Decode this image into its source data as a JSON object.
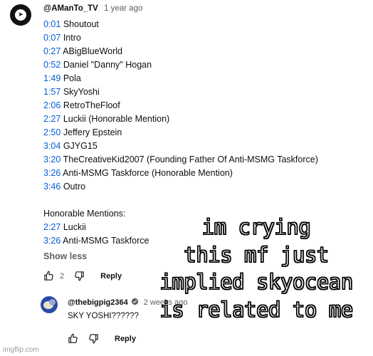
{
  "comment": {
    "handle": "@AManTo_TV",
    "time": "1 year ago",
    "lines": [
      {
        "ts": "0:01",
        "text": "Shoutout"
      },
      {
        "ts": "0:07",
        "text": "Intro"
      },
      {
        "ts": "0:27",
        "text": "ABigBlueWorld"
      },
      {
        "ts": "0:52",
        "text": "Daniel \"Danny\" Hogan"
      },
      {
        "ts": "1:49",
        "text": "Pola"
      },
      {
        "ts": "1:57",
        "text": "SkyYoshi"
      },
      {
        "ts": "2:06",
        "text": "RetroTheFloof"
      },
      {
        "ts": "2:27",
        "text": "Luckii (Honorable Mention)"
      },
      {
        "ts": "2:50",
        "text": "Jeffery Epstein"
      },
      {
        "ts": "3:04",
        "text": "GJYG15"
      },
      {
        "ts": "3:20",
        "text": "TheCreativeKid2007 (Founding Father Of Anti-MSMG Taskforce)"
      },
      {
        "ts": "3:26",
        "text": "Anti-MSMG Taskforce (Honorable Mention)"
      },
      {
        "ts": "3:46",
        "text": "Outro"
      }
    ],
    "honorable_heading": "Honorable Mentions:",
    "honorable": [
      {
        "ts": "2:27",
        "text": "Luckii"
      },
      {
        "ts": "3:26",
        "text": "Anti-MSMG Taskforce"
      }
    ],
    "show_less": "Show less",
    "like_count": "2",
    "reply_label": "Reply"
  },
  "reply": {
    "handle": "@thebigpig2364",
    "time": "2 weeks ago",
    "text": "SKY YOSHI??????",
    "reply_label": "Reply"
  },
  "overlay": {
    "lines": [
      "im crying",
      "this mf just",
      "implied skyocean",
      "is related to me"
    ]
  },
  "watermark": "imgflip.com",
  "icons": [
    "channel-avatar",
    "thumb-up-icon",
    "thumb-down-icon",
    "verified-check-icon"
  ],
  "colors": {
    "timestamp": "#065fd4",
    "muted": "#606060",
    "text": "#0f0f0f"
  }
}
